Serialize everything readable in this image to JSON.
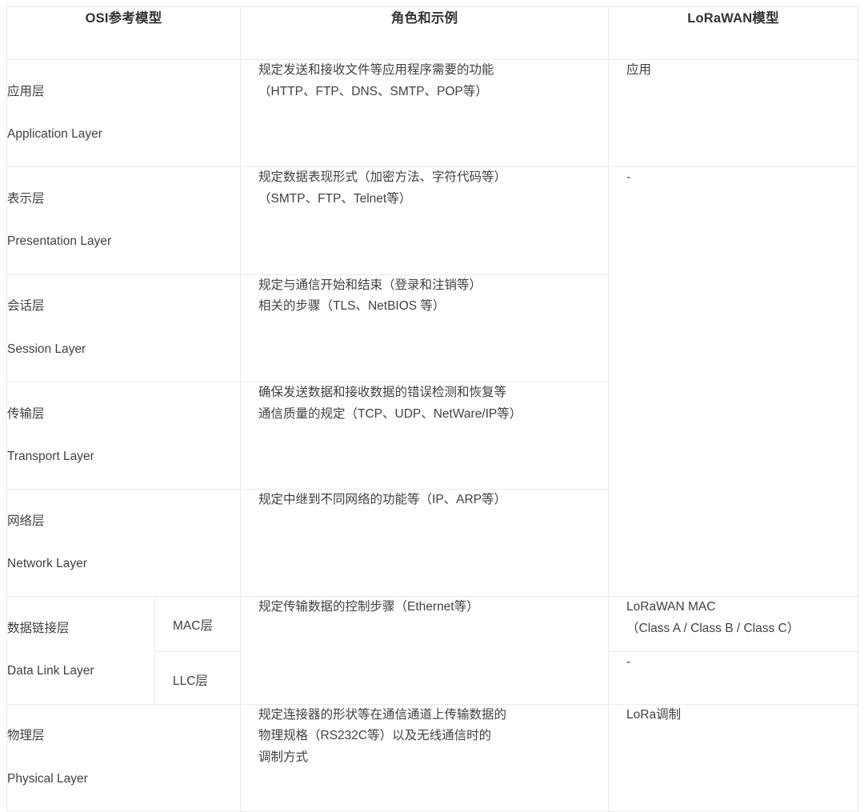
{
  "table": {
    "headers": [
      {
        "label": "OSI参考模型",
        "name": "header-osi-model"
      },
      {
        "label": "角色和示例",
        "name": "header-role-and-examples"
      },
      {
        "label": "LoRaWAN模型",
        "name": "header-lorawan-model"
      }
    ],
    "colors": {
      "header_background": "#f7f7f7",
      "header_text": "#333333",
      "body_text": "#3f4246",
      "border": "#ebebeb",
      "page_background": "#ffffff"
    },
    "rows": [
      {
        "id": "application",
        "osi_cn": "应用层",
        "osi_en": "Application Layer",
        "role": "规定发送和接收文件等应用程序需要的功能\n（HTTP、FTP、DNS、SMTP、POP等）",
        "lorawan": "应用"
      },
      {
        "id": "presentation",
        "osi_cn": "表示层",
        "osi_en": "Presentation Layer",
        "role": "规定数据表现形式（加密方法、字符代码等）\n（SMTP、FTP、Telnet等）",
        "lorawan": "-"
      },
      {
        "id": "session",
        "osi_cn": "会话层",
        "osi_en": "Session Layer",
        "role": "规定与通信开始和结束（登录和注销等）\n相关的步骤（TLS、NetBIOS 等）",
        "lorawan": ""
      },
      {
        "id": "transport",
        "osi_cn": "传输层",
        "osi_en": "Transport Layer",
        "role": "确保发送数据和接收数据的错误检测和恢复等\n通信质量的规定（TCP、UDP、NetWare/IP等）",
        "lorawan": ""
      },
      {
        "id": "network",
        "osi_cn": "网络层",
        "osi_en": "Network Layer",
        "role": "规定中继到不同网络的功能等（IP、ARP等）",
        "lorawan": ""
      },
      {
        "id": "datalink-mac",
        "osi_cn": "数据链接层",
        "osi_en": "Data Link Layer",
        "sub": "MAC层",
        "role": "规定传输数据的控制步骤（Ethernet等）",
        "lorawan": "LoRaWAN MAC\n（Class A / Class B / Class C）"
      },
      {
        "id": "datalink-llc",
        "sub": "LLC层",
        "lorawan": "-"
      },
      {
        "id": "physical",
        "osi_cn": "物理层",
        "osi_en": "Physical Layer",
        "role": "规定连接器的形状等在通信通道上传输数据的\n物理规格（RS232C等）以及无线通信时的\n调制方式",
        "lorawan": "LoRa调制"
      }
    ]
  }
}
